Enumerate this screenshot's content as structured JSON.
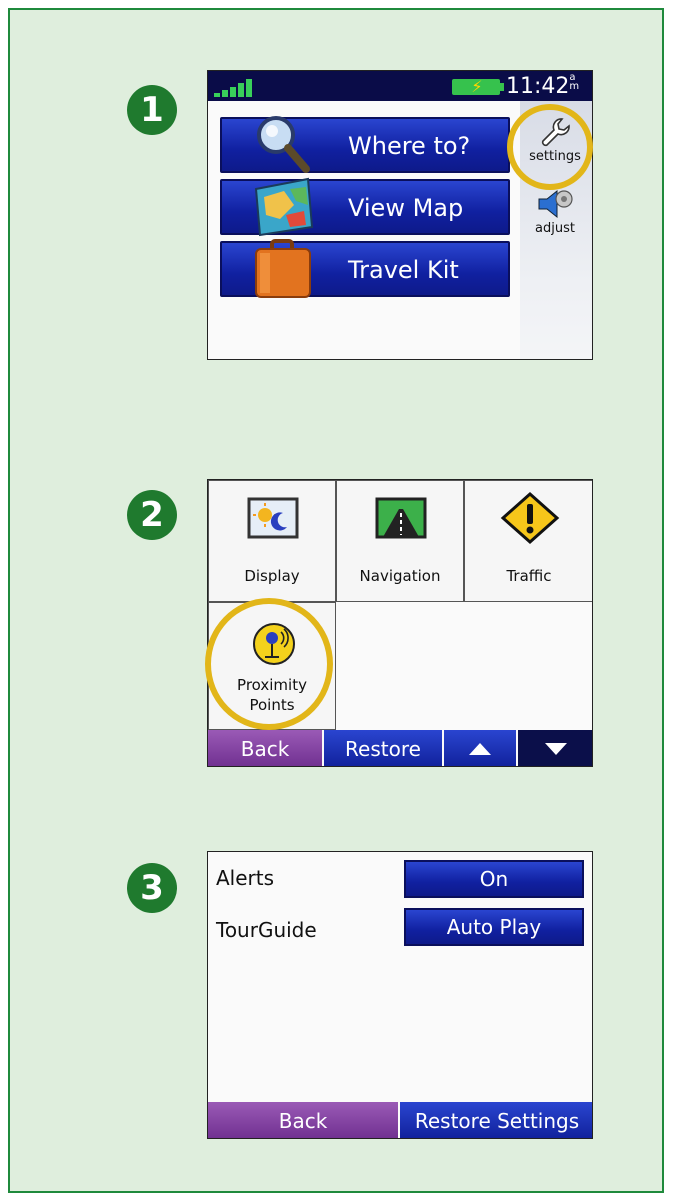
{
  "steps": [
    "1",
    "2",
    "3"
  ],
  "screen1": {
    "clock": "11:42",
    "clock_suffix": "am",
    "menu": [
      {
        "label": "Where to?",
        "icon": "magnifier-icon"
      },
      {
        "label": "View Map",
        "icon": "map-icon"
      },
      {
        "label": "Travel Kit",
        "icon": "suitcase-icon"
      }
    ],
    "side": [
      {
        "label": "settings",
        "icon": "wrench-icon"
      },
      {
        "label": "adjust",
        "icon": "speaker-icon"
      }
    ]
  },
  "screen2": {
    "tiles": [
      {
        "label": "Display",
        "icon": "display-icon"
      },
      {
        "label": "Navigation",
        "icon": "road-icon"
      },
      {
        "label": "Traffic",
        "icon": "warning-icon"
      },
      {
        "label_line1": "Proximity",
        "label_line2": "Points",
        "icon": "proximity-icon"
      }
    ],
    "nav": {
      "back": "Back",
      "restore": "Restore"
    }
  },
  "screen3": {
    "rows": [
      {
        "label": "Alerts",
        "value": "On"
      },
      {
        "label": "TourGuide",
        "value": "Auto Play"
      }
    ],
    "nav": {
      "back": "Back",
      "restore": "Restore Settings"
    }
  },
  "colors": {
    "panel_bg": "#dfeedd",
    "panel_border": "#1f8a3c",
    "step_circle": "#1f7a2e",
    "button_blue": "#1020a0",
    "back_purple": "#7a3a9a",
    "highlight_ring": "#e2b619",
    "status_bar": "#0a0c48"
  }
}
